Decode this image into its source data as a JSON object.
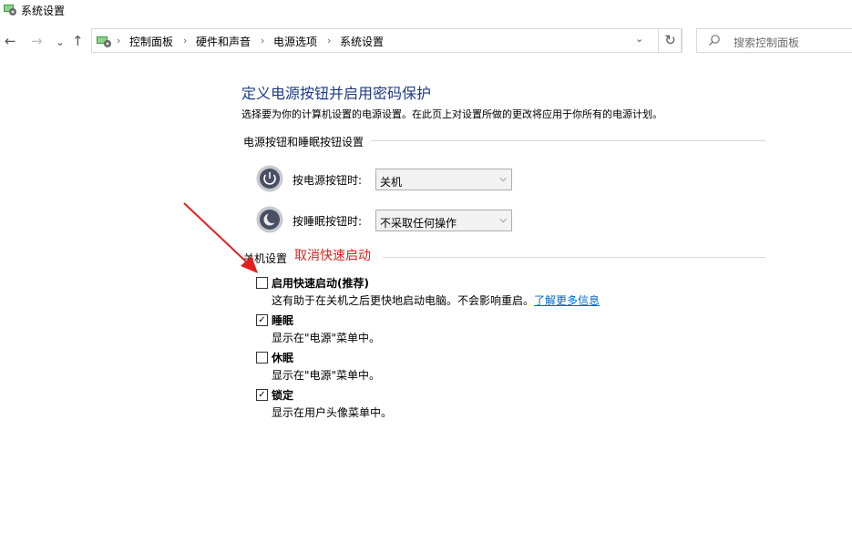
{
  "window": {
    "title": "系统设置"
  },
  "nav": {
    "back": "←",
    "forward": "→",
    "recent": "⌄",
    "up": "↑",
    "refresh": "↻"
  },
  "breadcrumb": {
    "items": [
      "控制面板",
      "硬件和声音",
      "电源选项",
      "系统设置"
    ],
    "separator": "›",
    "dropdown": "⌄"
  },
  "search": {
    "placeholder": "搜索控制面板",
    "icon": "search-icon"
  },
  "main": {
    "title": "定义电源按钮并启用密码保护",
    "description": "选择要为你的计算机设置的电源设置。在此页上对设置所做的更改将应用于你所有的电源计划。",
    "power_section": {
      "heading": "电源按钮和睡眠按钮设置",
      "power_button": {
        "label": "按电源按钮时:",
        "value": "关机",
        "icon": "power-icon"
      },
      "sleep_button": {
        "label": "按睡眠按钮时:",
        "value": "不采取任何操作",
        "icon": "sleep-icon"
      }
    },
    "shutdown_section": {
      "heading": "关机设置",
      "options": [
        {
          "title": "启用快速启动(推荐)",
          "desc": "这有助于在关机之后更快地启动电脑。不会影响重启。",
          "link": "了解更多信息",
          "checked": false
        },
        {
          "title": "睡眠",
          "desc": "显示在\"电源\"菜单中。",
          "checked": true
        },
        {
          "title": "休眠",
          "desc": "显示在\"电源\"菜单中。",
          "checked": false
        },
        {
          "title": "锁定",
          "desc": "显示在用户头像菜单中。",
          "checked": true
        }
      ]
    }
  },
  "annotation": {
    "text": "取消快速启动",
    "color": "#e02020"
  },
  "colors": {
    "title": "#1e3b8a",
    "link": "#0066cc",
    "annotation": "#e02020"
  }
}
